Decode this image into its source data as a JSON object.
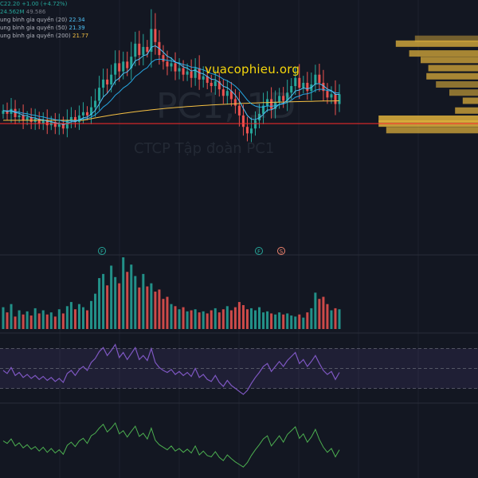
{
  "legend": {
    "price_row": {
      "close_prefix": "C",
      "close": "22.20",
      "change": "+1.00 (+4.72%)"
    },
    "volume_row": {
      "volume": "24.562M",
      "volume_ma": "49.586"
    },
    "ma_rows": [
      {
        "label": "ung bình gia quyền (20)",
        "value": "22.34",
        "color": "#4fc3f7"
      },
      {
        "label": "ung bình gia quyền (50)",
        "value": "21.39",
        "color": "#4fc3f7"
      },
      {
        "label": "ung bình gia quyền (200)",
        "value": "21.77",
        "color": "#f5c043"
      }
    ]
  },
  "watermarks": {
    "site": "vuacophieu.org",
    "ticker": "PC1, 1D",
    "company": "CTCP Tập đoàn PC1"
  },
  "events": [
    {
      "label": "F",
      "kind": "earnings"
    },
    {
      "label": "F",
      "kind": "earnings"
    },
    {
      "label": "S",
      "kind": "split"
    }
  ],
  "colors": {
    "background": "#131722",
    "up": "#26a69a",
    "down": "#ef5350",
    "ma20": "#4fc3f7",
    "ma50": "#29b6f6",
    "ma200": "#f5c043",
    "support_line": "#ff2b2b",
    "volume_profile": "#e0b23c",
    "rsi": "#7e57c2",
    "oscillator": "#4caf50"
  },
  "chart_data": {
    "type": "candlestick",
    "x_axis": "trading days",
    "y_range": [
      16.5,
      27.0
    ],
    "support_level": 20.4,
    "closes": [
      21.2,
      21.0,
      21.3,
      20.8,
      20.9,
      20.6,
      20.8,
      20.5,
      20.7,
      20.4,
      20.6,
      20.3,
      20.5,
      20.2,
      20.4,
      20.1,
      20.6,
      20.8,
      20.5,
      20.9,
      21.1,
      20.9,
      21.4,
      21.8,
      22.6,
      23.1,
      22.8,
      23.4,
      24.1,
      23.6,
      24.2,
      23.8,
      24.5,
      25.3,
      24.6,
      25.1,
      24.8,
      26.2,
      25.4,
      24.6,
      24.2,
      23.9,
      24.1,
      23.6,
      23.8,
      23.4,
      23.6,
      23.2,
      23.8,
      23.1,
      23.3,
      22.9,
      22.7,
      23.0,
      22.5,
      22.1,
      22.4,
      21.9,
      21.5,
      20.9,
      20.2,
      19.8,
      20.1,
      20.6,
      21.0,
      21.5,
      21.9,
      21.3,
      21.7,
      22.1,
      21.8,
      22.3,
      22.7,
      23.2,
      22.6,
      22.9,
      22.4,
      22.8,
      23.4,
      22.9,
      22.4,
      22.0,
      22.2,
      21.6,
      22.2
    ],
    "volume_series": [
      2.1,
      1.6,
      2.4,
      1.2,
      1.8,
      1.4,
      1.7,
      1.3,
      2.0,
      1.5,
      1.8,
      1.4,
      1.6,
      1.2,
      1.9,
      1.5,
      2.2,
      2.6,
      1.9,
      2.4,
      2.1,
      1.8,
      2.7,
      3.4,
      4.9,
      5.3,
      4.2,
      6.1,
      5.0,
      4.4,
      6.9,
      5.5,
      6.2,
      5.1,
      4.0,
      5.3,
      4.1,
      4.4,
      3.6,
      3.8,
      2.9,
      3.1,
      2.4,
      2.2,
      1.9,
      2.1,
      1.7,
      1.8,
      1.9,
      1.6,
      1.7,
      1.5,
      1.8,
      2.0,
      1.6,
      1.9,
      2.2,
      1.8,
      2.1,
      2.6,
      2.3,
      1.9,
      2.0,
      1.8,
      2.1,
      1.6,
      1.7,
      1.5,
      1.4,
      1.6,
      1.4,
      1.5,
      1.3,
      1.2,
      1.4,
      1.1,
      1.6,
      2.0,
      3.5,
      2.9,
      3.1,
      2.4,
      1.8,
      2.0,
      1.9
    ],
    "rsi_range": [
      20,
      80
    ],
    "rsi_bands": [
      30,
      50,
      70
    ],
    "rsi_series": [
      48,
      45,
      51,
      43,
      46,
      41,
      44,
      40,
      43,
      39,
      42,
      38,
      41,
      37,
      40,
      36,
      45,
      48,
      43,
      49,
      52,
      48,
      56,
      60,
      67,
      71,
      63,
      68,
      74,
      61,
      66,
      59,
      65,
      71,
      59,
      63,
      58,
      70,
      56,
      51,
      48,
      46,
      49,
      44,
      47,
      43,
      46,
      42,
      50,
      41,
      44,
      39,
      37,
      43,
      36,
      32,
      38,
      33,
      30,
      27,
      24,
      28,
      35,
      41,
      46,
      52,
      55,
      47,
      52,
      57,
      52,
      58,
      62,
      66,
      55,
      59,
      52,
      57,
      63,
      55,
      48,
      44,
      47,
      39,
      46
    ],
    "osc_series": [
      52,
      48,
      55,
      44,
      49,
      41,
      46,
      39,
      43,
      36,
      42,
      34,
      40,
      33,
      38,
      31,
      45,
      50,
      43,
      52,
      56,
      48,
      60,
      64,
      72,
      78,
      66,
      72,
      80,
      63,
      68,
      58,
      67,
      75,
      59,
      64,
      55,
      72,
      53,
      46,
      42,
      38,
      44,
      36,
      40,
      34,
      39,
      33,
      44,
      30,
      36,
      29,
      27,
      35,
      26,
      21,
      30,
      24,
      19,
      15,
      11,
      18,
      29,
      38,
      46,
      55,
      60,
      44,
      52,
      60,
      50,
      62,
      68,
      74,
      56,
      63,
      50,
      58,
      70,
      54,
      42,
      34,
      40,
      27,
      38
    ]
  }
}
